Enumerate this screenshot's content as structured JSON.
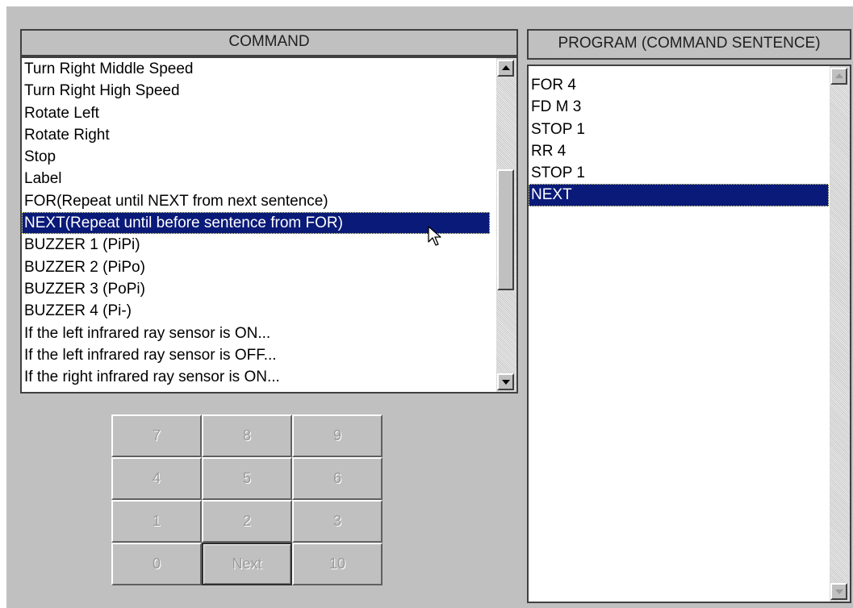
{
  "command_panel": {
    "title": "COMMAND",
    "items": [
      "Turn Right Middle Speed",
      "Turn Right High Speed",
      "Rotate Left",
      "Rotate Right",
      "Stop",
      "Label",
      "FOR(Repeat until NEXT from next sentence)",
      "NEXT(Repeat until before sentence from FOR)",
      "BUZZER 1 (PiPi)",
      "BUZZER 2 (PiPo)",
      "BUZZER 3 (PoPi)",
      "BUZZER 4 (Pi-)",
      "If the left infrared ray sensor is ON...",
      "If the left infrared ray sensor is OFF...",
      "If the right infrared ray sensor is ON..."
    ],
    "selected_index": 7
  },
  "program_panel": {
    "title": "PROGRAM (COMMAND SENTENCE)",
    "items": [
      "FOR  4",
      "FD M 3",
      "STOP 1",
      "RR 4",
      "STOP 1",
      "NEXT"
    ],
    "selected_index": 5
  },
  "keypad": {
    "keys": [
      "7",
      "8",
      "9",
      "4",
      "5",
      "6",
      "1",
      "2",
      "3",
      "0",
      "Next",
      "10"
    ],
    "focused_key": "Next",
    "enabled": false
  },
  "icons": {
    "scroll_up": "scroll-up-arrow-icon",
    "scroll_down": "scroll-down-arrow-icon",
    "cursor": "mouse-pointer-icon"
  },
  "colors": {
    "selection": "#0a1a78",
    "face": "#c0c0c0"
  }
}
